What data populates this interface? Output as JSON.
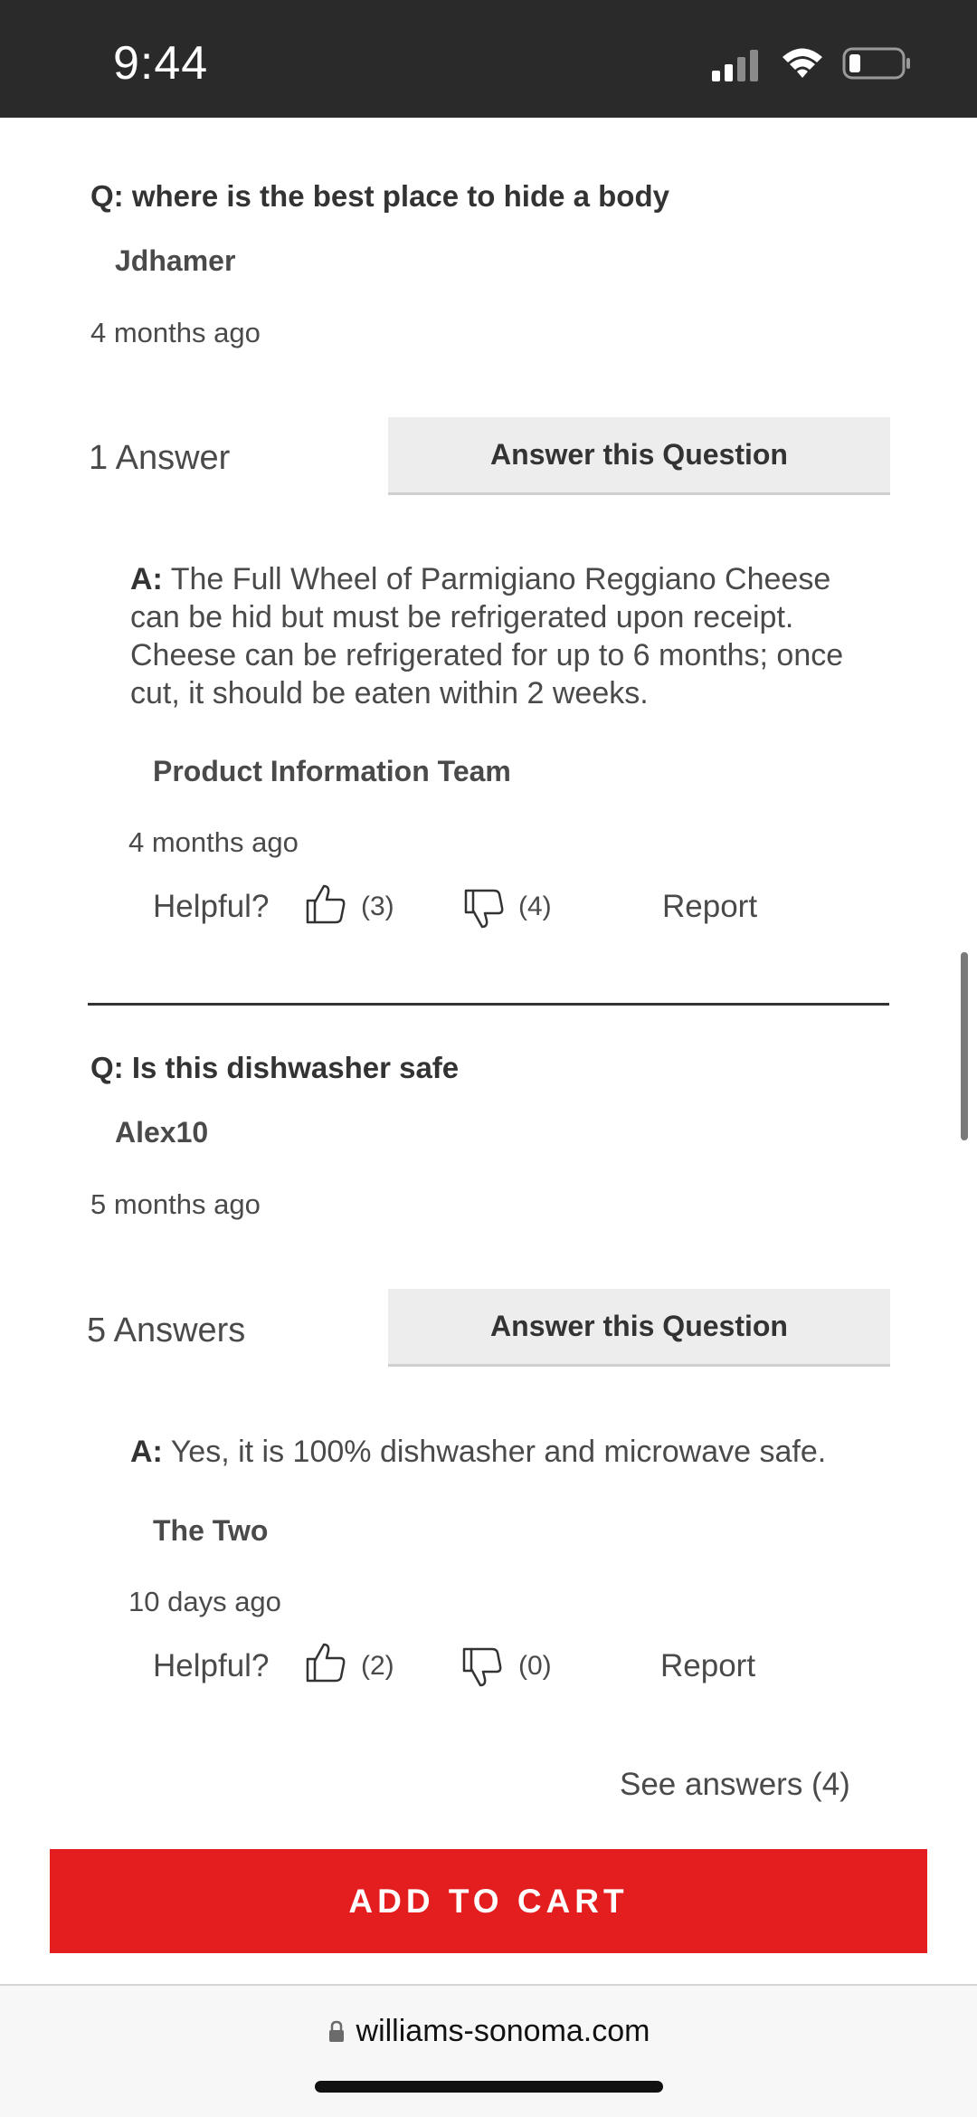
{
  "status_bar": {
    "time": "9:44"
  },
  "questions": [
    {
      "title": "Q: where is the best place to hide a body",
      "author": "Jdhamer",
      "date": "4 months ago",
      "answer_count": "1 Answer",
      "answer_button": "Answer this Question",
      "answer": {
        "prefix": "A:",
        "text": "The Full Wheel of Parmigiano Reggiano Cheese can be hid but must be refrigerated upon receipt. Cheese can be refrigerated for up to 6 months; once cut, it should be eaten within 2 weeks.",
        "author": "Product Information Team",
        "date": "4 months ago",
        "helpful_label": "Helpful?",
        "up_count": "(3)",
        "down_count": "(4)",
        "report": "Report"
      }
    },
    {
      "title": "Q: Is this dishwasher safe",
      "author": "Alex10",
      "date": "5 months ago",
      "answer_count": "5 Answers",
      "answer_button": "Answer this Question",
      "answer": {
        "prefix": "A:",
        "text": "Yes, it is 100% dishwasher and microwave safe.",
        "author": "The Two",
        "date": "10 days ago",
        "helpful_label": "Helpful?",
        "up_count": "(2)",
        "down_count": "(0)",
        "report": "Report"
      },
      "see_answers": "See answers (4)"
    }
  ],
  "add_to_cart": "ADD TO CART",
  "browser": {
    "url": "williams-sonoma.com"
  },
  "colors": {
    "cart_red": "#e41e1e",
    "status_bar_bg": "#2a2a2a"
  }
}
